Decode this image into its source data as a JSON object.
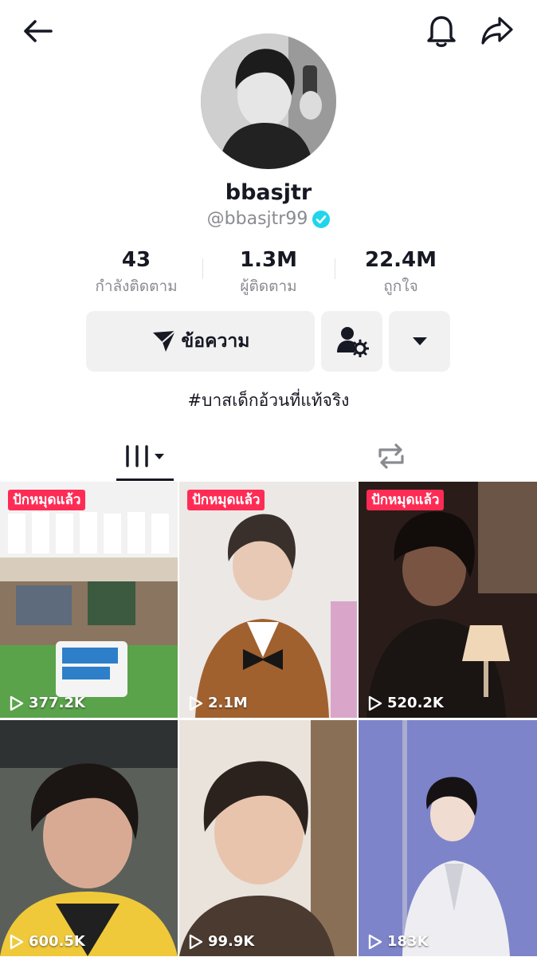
{
  "profile": {
    "username": "bbasjtr",
    "handle": "@bbasjtr99",
    "verified": true,
    "bio": "#บาสเด็กอ้วนที่แท้จริง"
  },
  "stats": [
    {
      "value": "43",
      "label": "กำลังติดตาม"
    },
    {
      "value": "1.3M",
      "label": "ผู้ติดตาม"
    },
    {
      "value": "22.4M",
      "label": "ถูกใจ"
    }
  ],
  "actions": {
    "message_label": "ข้อความ"
  },
  "tabs": {
    "active": "videos"
  },
  "videos": [
    {
      "pinned": true,
      "pin_label": "ปักหมุดแล้ว",
      "views": "377.2K"
    },
    {
      "pinned": true,
      "pin_label": "ปักหมุดแล้ว",
      "views": "2.1M"
    },
    {
      "pinned": true,
      "pin_label": "ปักหมุดแล้ว",
      "views": "520.2K"
    },
    {
      "pinned": false,
      "views": "600.5K"
    },
    {
      "pinned": false,
      "views": "99.9K"
    },
    {
      "pinned": false,
      "views": "183K"
    }
  ],
  "colors": {
    "accent_pin": "#fe2c55",
    "verified": "#20d5ec",
    "button_bg": "#f1f1f2",
    "secondary_text": "#8a8b91"
  }
}
